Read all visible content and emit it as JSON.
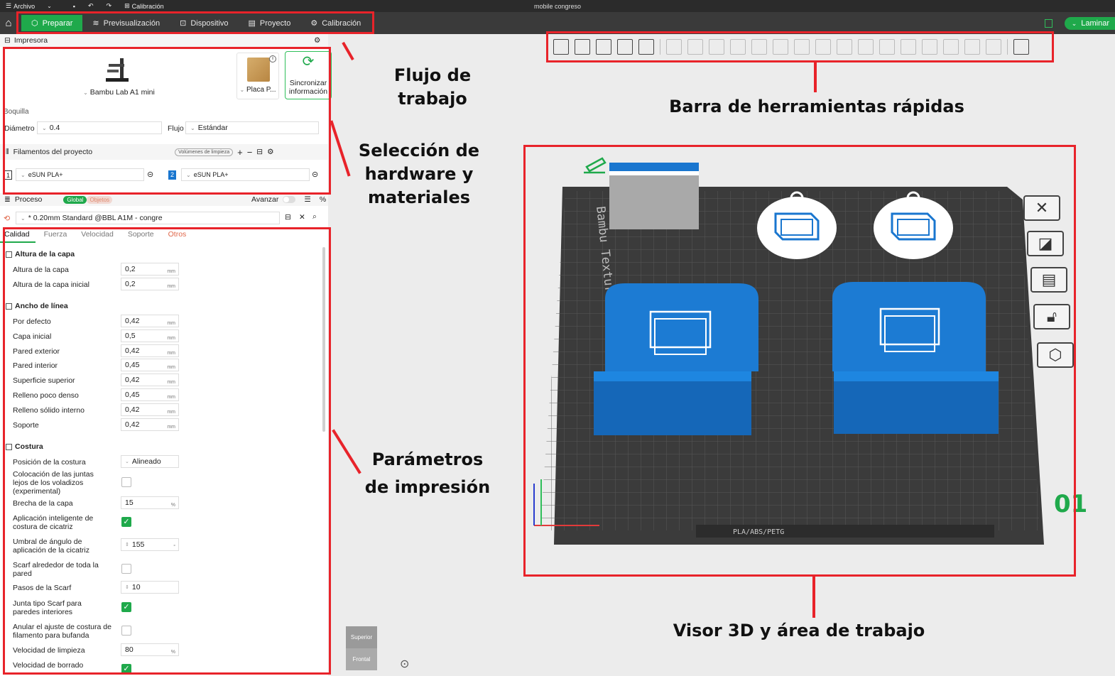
{
  "window": {
    "title": "mobile congreso",
    "menu_file": "Archivo",
    "menu_calibration": "Calibración"
  },
  "tabs": [
    {
      "label": "Preparar"
    },
    {
      "label": "Previsualización"
    },
    {
      "label": "Dispositivo"
    },
    {
      "label": "Proyecto"
    },
    {
      "label": "Calibración"
    }
  ],
  "slice_button": "Laminar",
  "printer": {
    "header": "Impresora",
    "name": "Bambu Lab A1 mini",
    "plate": "Placa P...",
    "sync": "Sincronizar información",
    "nozzle_label": "Boquilla",
    "diameter_label": "Diámetro",
    "diameter_value": "0.4",
    "flow_label": "Flujo",
    "flow_value": "Estándar"
  },
  "filaments": {
    "header": "Filamentos del proyecto",
    "purge_button": "Volúmenes de limpieza",
    "items": [
      {
        "num": "1",
        "name": "eSUN PLA+"
      },
      {
        "num": "2",
        "name": "eSUN PLA+"
      }
    ]
  },
  "process": {
    "header": "Proceso",
    "global": "Global",
    "objects": "Objetos",
    "advanced": "Avanzar",
    "preset": "* 0.20mm Standard @BBL A1M - congre",
    "tabs": [
      "Calidad",
      "Fuerza",
      "Velocidad",
      "Soporte",
      "Otros"
    ]
  },
  "params": {
    "layer_section": "Altura de la capa",
    "layer_height": {
      "label": "Altura de la capa",
      "value": "0,2",
      "unit": "mm"
    },
    "initial_layer": {
      "label": "Altura de la capa inicial",
      "value": "0,2",
      "unit": "mm"
    },
    "width_section": "Ancho de línea",
    "widths": [
      {
        "label": "Por defecto",
        "value": "0,42",
        "unit": "mm"
      },
      {
        "label": "Capa inicial",
        "value": "0,5",
        "unit": "mm"
      },
      {
        "label": "Pared exterior",
        "value": "0,42",
        "unit": "mm"
      },
      {
        "label": "Pared interior",
        "value": "0,45",
        "unit": "mm"
      },
      {
        "label": "Superficie superior",
        "value": "0,42",
        "unit": "mm"
      },
      {
        "label": "Relleno poco denso",
        "value": "0,45",
        "unit": "mm"
      },
      {
        "label": "Relleno sólido interno",
        "value": "0,42",
        "unit": "mm"
      },
      {
        "label": "Soporte",
        "value": "0,42",
        "unit": "mm"
      }
    ],
    "seam_section": "Costura",
    "seam_position": {
      "label": "Posición de la costura",
      "value": "Alineado"
    },
    "seam_overhang": {
      "label": "Colocación de las juntas lejos de los voladizos (experimental)",
      "checked": false
    },
    "seam_gap": {
      "label": "Brecha de la capa",
      "value": "15",
      "unit": "%"
    },
    "smart_scarf": {
      "label": "Aplicación inteligente de costura de cicatriz",
      "checked": true
    },
    "scarf_angle": {
      "label": "Umbral de ángulo de aplicación de la cicatriz",
      "value": "155",
      "unit": "°"
    },
    "scarf_around": {
      "label": "Scarf alrededor de toda la pared",
      "checked": false
    },
    "scarf_steps": {
      "label": "Pasos de la Scarf",
      "value": "10"
    },
    "scarf_inner": {
      "label": "Junta tipo Scarf para paredes interiores",
      "checked": true
    },
    "cancel_seam": {
      "label": "Anular el ajuste de costura de filamento para bufanda",
      "checked": false
    },
    "wipe_speed": {
      "label": "Velocidad de limpieza",
      "value": "80",
      "unit": "%"
    },
    "wipe_erase": {
      "label": "Velocidad de borrado",
      "checked": true
    }
  },
  "annotations": {
    "workflow": "Flujo de trabajo",
    "quick_toolbar": "Barra de herramientas rápidas",
    "hardware": "Selección de hardware y materiales",
    "params": "Parámetros de impresión",
    "viewer": "Visor 3D y área de trabajo"
  },
  "viewer": {
    "plate_name": "Bambu Textured PEI Plate",
    "plate_materials": "PLA/ABS/PETG",
    "plate_number": "01",
    "navcube_top": "Superior",
    "navcube_front": "Frontal"
  },
  "colors": {
    "accent": "#1fa94b",
    "annotation": "#e8232a",
    "model": "#1976cf"
  }
}
